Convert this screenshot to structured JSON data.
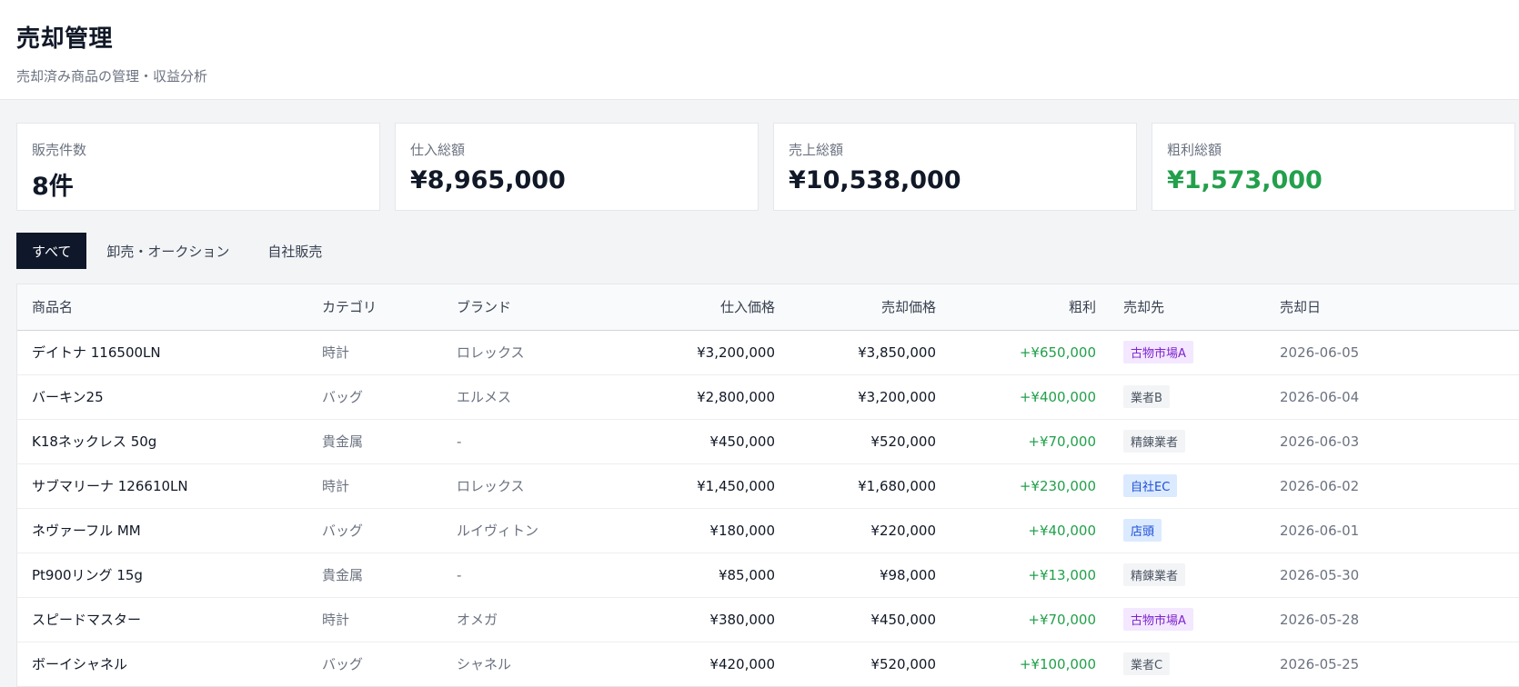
{
  "header": {
    "title": "売却管理",
    "subtitle": "売却済み商品の管理・収益分析"
  },
  "stats": [
    {
      "label": "販売件数",
      "value": "8件",
      "color": "#111827"
    },
    {
      "label": "仕入総額",
      "value": "¥8,965,000",
      "color": "#111827"
    },
    {
      "label": "売上総額",
      "value": "¥10,538,000",
      "color": "#111827"
    },
    {
      "label": "粗利総額",
      "value": "¥1,573,000",
      "color": "#22a04b"
    }
  ],
  "tabs": [
    {
      "label": "すべて",
      "active": true
    },
    {
      "label": "卸売・オークション",
      "active": false
    },
    {
      "label": "自社販売",
      "active": false
    }
  ],
  "table": {
    "columns": [
      "商品名",
      "カテゴリ",
      "ブランド",
      "仕入価格",
      "売却価格",
      "粗利",
      "売却先",
      "売却日"
    ],
    "rows": [
      {
        "name": "デイトナ 116500LN",
        "category": "時計",
        "brand": "ロレックス",
        "cost": "¥3,200,000",
        "price": "¥3,850,000",
        "profit": "+¥650,000",
        "buyer": "古物市場A",
        "buyer_style": "purple",
        "date": "2026-06-05"
      },
      {
        "name": "バーキン25",
        "category": "バッグ",
        "brand": "エルメス",
        "cost": "¥2,800,000",
        "price": "¥3,200,000",
        "profit": "+¥400,000",
        "buyer": "業者B",
        "buyer_style": "gray",
        "date": "2026-06-04"
      },
      {
        "name": "K18ネックレス 50g",
        "category": "貴金属",
        "brand": "-",
        "cost": "¥450,000",
        "price": "¥520,000",
        "profit": "+¥70,000",
        "buyer": "精錬業者",
        "buyer_style": "gray",
        "date": "2026-06-03"
      },
      {
        "name": "サブマリーナ 126610LN",
        "category": "時計",
        "brand": "ロレックス",
        "cost": "¥1,450,000",
        "price": "¥1,680,000",
        "profit": "+¥230,000",
        "buyer": "自社EC",
        "buyer_style": "blue",
        "date": "2026-06-02"
      },
      {
        "name": "ネヴァーフル MM",
        "category": "バッグ",
        "brand": "ルイヴィトン",
        "cost": "¥180,000",
        "price": "¥220,000",
        "profit": "+¥40,000",
        "buyer": "店頭",
        "buyer_style": "blue",
        "date": "2026-06-01"
      },
      {
        "name": "Pt900リング 15g",
        "category": "貴金属",
        "brand": "-",
        "cost": "¥85,000",
        "price": "¥98,000",
        "profit": "+¥13,000",
        "buyer": "精錬業者",
        "buyer_style": "gray",
        "date": "2026-05-30"
      },
      {
        "name": "スピードマスター",
        "category": "時計",
        "brand": "オメガ",
        "cost": "¥380,000",
        "price": "¥450,000",
        "profit": "+¥70,000",
        "buyer": "古物市場A",
        "buyer_style": "purple",
        "date": "2026-05-28"
      },
      {
        "name": "ボーイシャネル",
        "category": "バッグ",
        "brand": "シャネル",
        "cost": "¥420,000",
        "price": "¥520,000",
        "profit": "+¥100,000",
        "buyer": "業者C",
        "buyer_style": "gray",
        "date": "2026-05-25"
      }
    ]
  },
  "badge_colors": {
    "purple": {
      "bg": "#f3e8ff",
      "fg": "#7e22ce"
    },
    "gray": {
      "bg": "#f3f4f6",
      "fg": "#4b5563"
    },
    "blue": {
      "bg": "#dbeafe",
      "fg": "#1d4ed8"
    }
  }
}
